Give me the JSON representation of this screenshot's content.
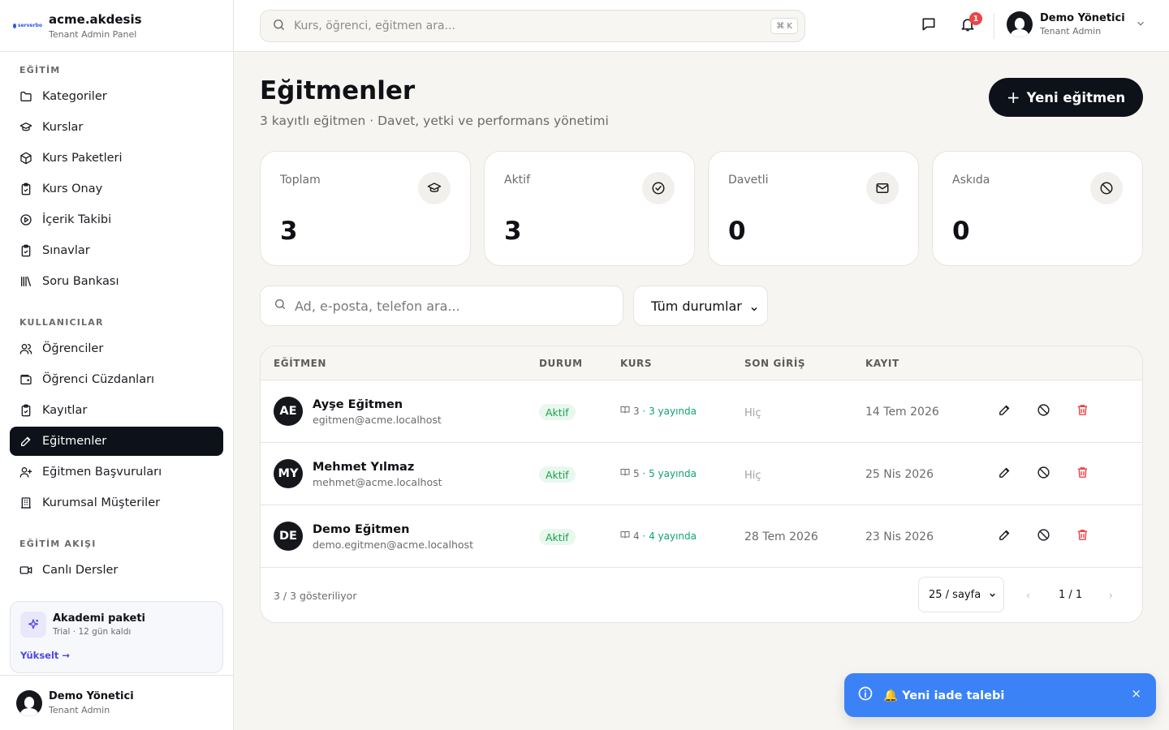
{
  "brand": {
    "logo_text": "serverbo",
    "name": "acme.akdesis",
    "subtitle": "Tenant Admin Panel"
  },
  "sidebar": {
    "sections": [
      {
        "title": "EĞİTİM",
        "items": [
          {
            "label": "Kategoriler",
            "icon": "folder-icon"
          },
          {
            "label": "Kurslar",
            "icon": "graduation-cap-icon"
          },
          {
            "label": "Kurs Paketleri",
            "icon": "package-icon"
          },
          {
            "label": "Kurs Onay",
            "icon": "clipboard-check-icon"
          },
          {
            "label": "İçerik Takibi",
            "icon": "play-circle-icon"
          },
          {
            "label": "Sınavlar",
            "icon": "clipboard-check-icon"
          },
          {
            "label": "Soru Bankası",
            "icon": "library-icon"
          }
        ]
      },
      {
        "title": "KULLANICILAR",
        "items": [
          {
            "label": "Öğrenciler",
            "icon": "users-icon"
          },
          {
            "label": "Öğrenci Cüzdanları",
            "icon": "wallet-icon"
          },
          {
            "label": "Kayıtlar",
            "icon": "clipboard-check-icon"
          },
          {
            "label": "Eğitmenler",
            "icon": "pencil-icon",
            "active": true
          },
          {
            "label": "Eğitmen Başvuruları",
            "icon": "user-plus-icon"
          },
          {
            "label": "Kurumsal Müşteriler",
            "icon": "building-icon"
          }
        ]
      },
      {
        "title": "EĞİTİM AKIŞI",
        "items": [
          {
            "label": "Canlı Dersler",
            "icon": "video-icon"
          }
        ]
      }
    ],
    "promo": {
      "title": "Akademi paketi",
      "subtitle": "Trial · 12 gün kaldı",
      "link": "Yükselt →"
    },
    "user": {
      "name": "Demo Yönetici",
      "role": "Tenant Admin"
    }
  },
  "topbar": {
    "search_placeholder": "Kurs, öğrenci, eğitmen ara...",
    "shortcut": "⌘ K",
    "notification_count": "1",
    "user": {
      "name": "Demo Yönetici",
      "role": "Tenant Admin"
    }
  },
  "page": {
    "title": "Eğitmenler",
    "subtitle": "3 kayıtlı eğitmen · Davet, yetki ve performans yönetimi",
    "new_button": "Yeni eğitmen"
  },
  "stats": [
    {
      "label": "Toplam",
      "value": "3",
      "icon": "graduation-cap-icon"
    },
    {
      "label": "Aktif",
      "value": "3",
      "icon": "check-circle-icon"
    },
    {
      "label": "Davetli",
      "value": "0",
      "icon": "mail-icon"
    },
    {
      "label": "Askıda",
      "value": "0",
      "icon": "ban-icon"
    }
  ],
  "filters": {
    "search_placeholder": "Ad, e-posta, telefon ara...",
    "status_selected": "Tüm durumlar"
  },
  "table": {
    "headers": {
      "instructor": "EĞİTMEN",
      "status": "DURUM",
      "course": "KURS",
      "last_login": "SON GİRİŞ",
      "registered": "KAYIT"
    },
    "rows": [
      {
        "initials": "AE",
        "name": "Ayşe Eğitmen",
        "email": "egitmen@acme.localhost",
        "status": "Aktif",
        "courses": "3",
        "published": "3 yayında",
        "last_login": "Hiç",
        "registered": "14 Tem 2026"
      },
      {
        "initials": "MY",
        "name": "Mehmet Yılmaz",
        "email": "mehmet@acme.localhost",
        "status": "Aktif",
        "courses": "5",
        "published": "5 yayında",
        "last_login": "Hiç",
        "registered": "25 Nis 2026"
      },
      {
        "initials": "DE",
        "name": "Demo Eğitmen",
        "email": "demo.egitmen@acme.localhost",
        "status": "Aktif",
        "courses": "4",
        "published": "4 yayında",
        "last_login": "28 Tem 2026",
        "registered": "23 Nis 2026"
      }
    ],
    "footer": {
      "showing": "3 / 3 gösteriliyor",
      "per_page": "25 / sayfa",
      "prev": "‹",
      "page": "1 / 1",
      "next": "›"
    }
  },
  "toast": {
    "message": "🔔 Yeni iade talebi",
    "close": "×"
  },
  "colors": {
    "primary": "#0d1119",
    "accent": "#4f46e5",
    "success": "#16a34a",
    "danger": "#ef4444",
    "toast": "#3b82f6"
  }
}
